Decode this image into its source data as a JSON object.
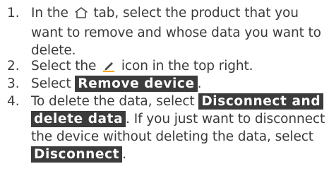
{
  "steps": [
    {
      "number": "1.",
      "before": "In the",
      "icon": "home-icon",
      "after": "tab, select the product that you want to remove and whose data you want to delete."
    },
    {
      "number": "2.",
      "before": "Select the",
      "icon": "pencil-edit-icon",
      "after": "icon in the top right."
    },
    {
      "number": "3.",
      "before": "Select",
      "button": "Remove device",
      "after": "."
    },
    {
      "number": "4.",
      "before": "To delete the data, select",
      "button1": "Disconnect and delete data",
      "middle": ". If you just want to disconnect the device without deleting the data, select",
      "button2": "Disconnect",
      "after": "."
    }
  ],
  "colors": {
    "text": "#3a3a3a",
    "button_bg": "#3c3c3c",
    "button_text": "#ffffff",
    "icon_underline": "#f5a623"
  }
}
